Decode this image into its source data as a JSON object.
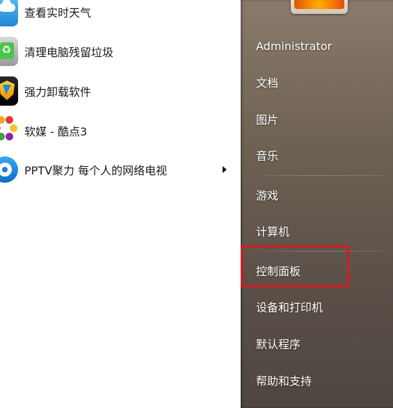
{
  "programs": [
    {
      "label": "查看实时天气",
      "icon": "weather-icon"
    },
    {
      "label": "清理电脑残留垃圾",
      "icon": "cleanup-icon"
    },
    {
      "label": "强力卸载软件",
      "icon": "uninstall-shield-icon"
    },
    {
      "label": "软媒 - 酷点3",
      "icon": "kudian-icon"
    },
    {
      "label": "PPTV聚力 每个人的网络电视",
      "icon": "pptv-icon",
      "has_submenu": true
    }
  ],
  "places": {
    "user": "Administrator",
    "documents": "文档",
    "pictures": "图片",
    "music": "音乐",
    "games": "游戏",
    "computer": "计算机",
    "control_panel": "控制面板",
    "devices_printers": "设备和打印机",
    "default_programs": "默认程序",
    "help_support": "帮助和支持"
  },
  "colors": {
    "highlight": "#e0141e",
    "pane_dark": "#5b5048"
  }
}
